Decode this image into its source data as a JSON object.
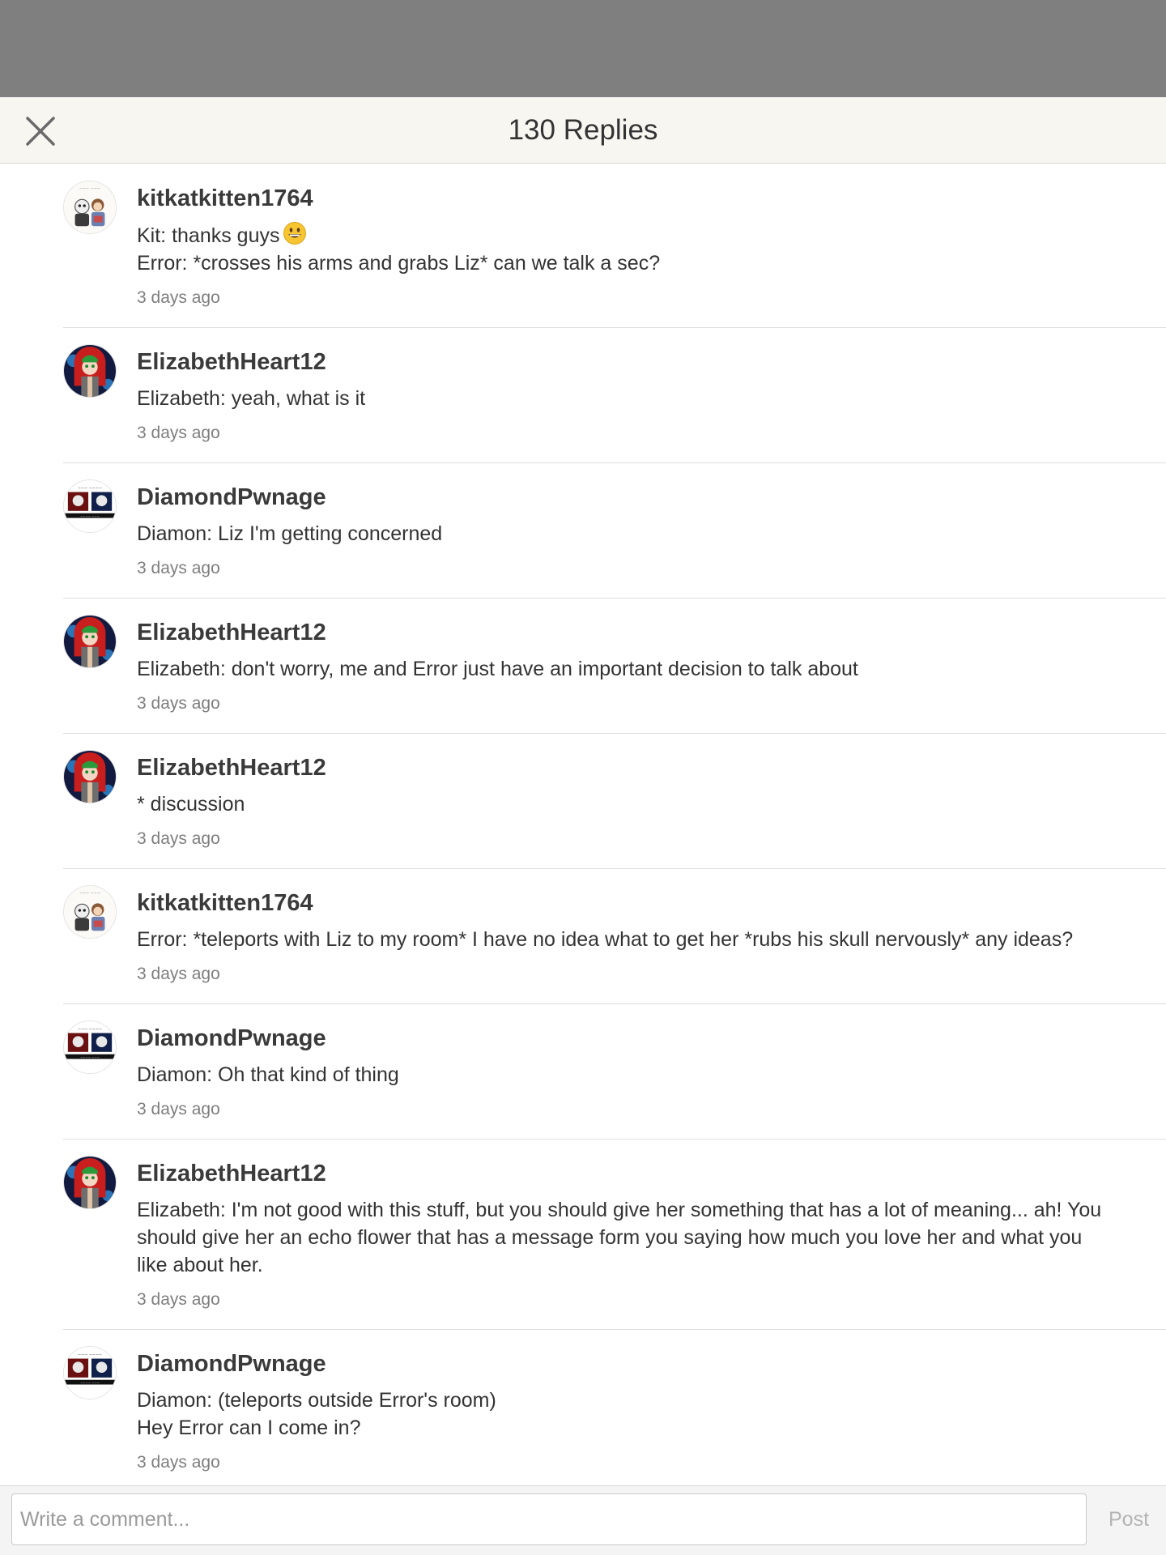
{
  "header": {
    "title": "130 Replies",
    "close_icon": "close-icon"
  },
  "replies": [
    {
      "username": "kitkatkitten1764",
      "avatar": "kitkat",
      "message": "Kit: thanks guys",
      "emoji": "grinning-face-emoji",
      "message_extra": "Error: *crosses his arms and grabs Liz* can we talk a sec?",
      "time": "3 days ago"
    },
    {
      "username": "ElizabethHeart12",
      "avatar": "elizabeth",
      "message": "Elizabeth: yeah, what is it",
      "time": "3 days ago"
    },
    {
      "username": "DiamondPwnage",
      "avatar": "diamond",
      "message": "Diamon: Liz I'm getting concerned",
      "time": "3 days ago"
    },
    {
      "username": "ElizabethHeart12",
      "avatar": "elizabeth",
      "message": "Elizabeth: don't worry, me and Error just have an important decision to talk about",
      "time": "3 days ago"
    },
    {
      "username": "ElizabethHeart12",
      "avatar": "elizabeth",
      "message": "* discussion",
      "time": "3 days ago"
    },
    {
      "username": "kitkatkitten1764",
      "avatar": "kitkat",
      "message": "Error: *teleports with Liz to my room* I have no idea what to get her *rubs his skull nervously* any ideas?",
      "time": "3 days ago"
    },
    {
      "username": "DiamondPwnage",
      "avatar": "diamond",
      "message": "Diamon: Oh that kind of thing",
      "time": "3 days ago"
    },
    {
      "username": "ElizabethHeart12",
      "avatar": "elizabeth",
      "message": "Elizabeth: I'm not good with this stuff, but you should give her something that has a lot of meaning... ah! You should give her an echo flower that has a message form you saying how much you love her and what you like about her.",
      "time": "3 days ago"
    },
    {
      "username": "DiamondPwnage",
      "avatar": "diamond",
      "message": "Diamon: (teleports outside Error's room)\nHey Error can I come in?",
      "time": "3 days ago"
    }
  ],
  "comment_bar": {
    "placeholder": "Write a comment...",
    "post_label": "Post"
  },
  "colors": {
    "overlay": "#7f7f7f",
    "header_bg": "#f7f6f1",
    "post_disabled": "#b4b4b4"
  }
}
